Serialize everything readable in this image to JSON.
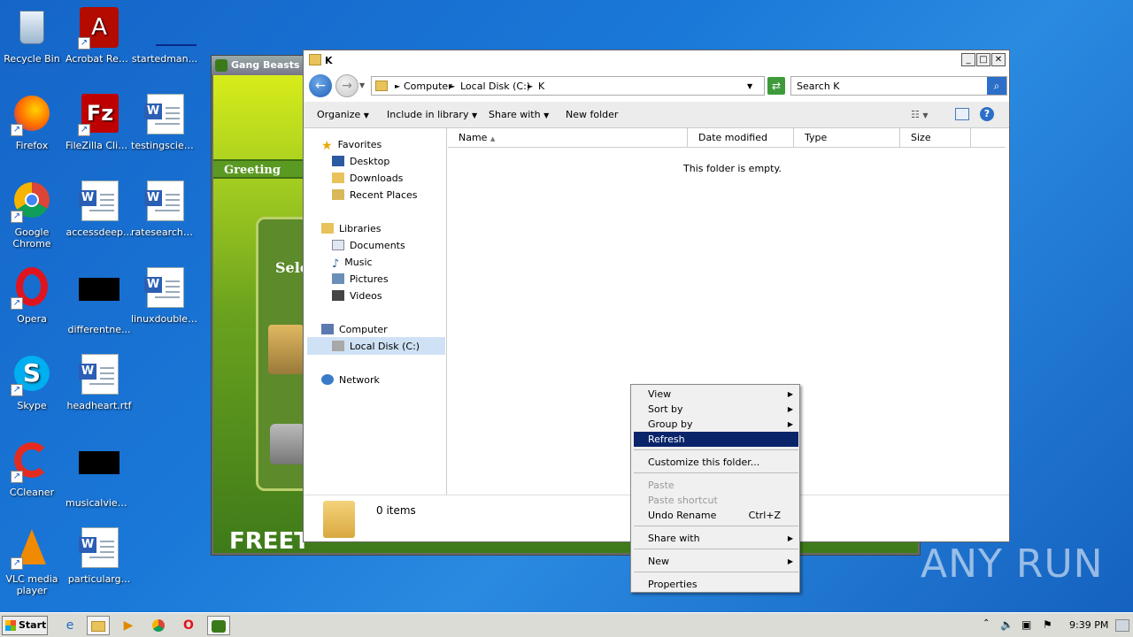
{
  "desktop": {
    "icons": [
      {
        "label": "Recycle Bin"
      },
      {
        "label": "Acrobat Reader DC"
      },
      {
        "label": "startedman..."
      },
      {
        "label": "Firefox"
      },
      {
        "label": "FileZilla Client"
      },
      {
        "label": "testingscien..."
      },
      {
        "label": "Google Chrome"
      },
      {
        "label": "accessdeep..."
      },
      {
        "label": "ratesearche..."
      },
      {
        "label": "Opera"
      },
      {
        "label": "differentne..."
      },
      {
        "label": "linuxdouble.rtf"
      },
      {
        "label": "Skype"
      },
      {
        "label": "headheart.rtf"
      },
      {
        "label": "CCleaner"
      },
      {
        "label": "musicalview..."
      },
      {
        "label": "VLC media player"
      },
      {
        "label": "particularg..."
      }
    ]
  },
  "gang_beasts": {
    "title": "Gang Beasts",
    "greeting": "Greeting",
    "select": "Sele",
    "free_text": "FREET"
  },
  "explorer": {
    "title": "K",
    "breadcrumb": [
      "Computer",
      "Local Disk (C:)",
      "K"
    ],
    "search_placeholder": "Search K",
    "toolbar": {
      "organize": "Organize",
      "include_in_library": "Include in library",
      "share_with": "Share with",
      "new_folder": "New folder"
    },
    "nav": {
      "favorites": "Favorites",
      "desktop": "Desktop",
      "downloads": "Downloads",
      "recent_places": "Recent Places",
      "libraries": "Libraries",
      "documents": "Documents",
      "music": "Music",
      "pictures": "Pictures",
      "videos": "Videos",
      "computer": "Computer",
      "local_disk": "Local Disk (C:)",
      "network": "Network"
    },
    "columns": [
      "Name",
      "Date modified",
      "Type",
      "Size"
    ],
    "empty_message": "This folder is empty.",
    "item_count": "0 items"
  },
  "context_menu": {
    "view": "View",
    "sort_by": "Sort by",
    "group_by": "Group by",
    "refresh": "Refresh",
    "customize": "Customize this folder...",
    "paste": "Paste",
    "paste_shortcut": "Paste shortcut",
    "undo_rename": "Undo Rename",
    "undo_shortcut": "Ctrl+Z",
    "share_with": "Share with",
    "new": "New",
    "properties": "Properties"
  },
  "taskbar": {
    "start": "Start",
    "clock": "9:39 PM"
  },
  "watermark": "ANY RUN"
}
